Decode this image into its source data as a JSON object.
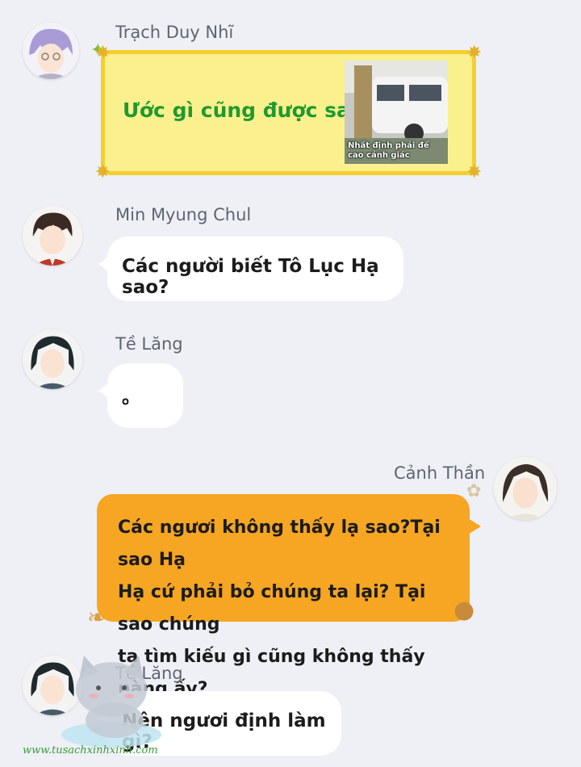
{
  "messages": [
    {
      "sender": "Trạch Duy Nhĩ",
      "text": "Ước gì cũng được sao?",
      "image_caption": "Nhất định phải để cao cảnh giác"
    },
    {
      "sender": "Min Myung Chul",
      "text": "Các người biết Tô Lục Hạ sao?"
    },
    {
      "sender": "Tề Lăng",
      "text": "。"
    },
    {
      "sender": "Cảnh Thần",
      "lines": [
        "Các ngươi không thấy lạ sao?Tại sao Hạ",
        "Hạ cứ phải bỏ chúng ta lại? Tại sao chúng",
        "ta tìm kiếu gì cũng không thấy nàng ấy?"
      ]
    },
    {
      "sender": "Tề Lăng",
      "text": "Nên ngươi định làm gì?"
    }
  ],
  "watermark": "www.tusachxinhxinh.com",
  "colors": {
    "background": "#eef0f6",
    "yellow_bubble": "#fbf08e",
    "yellow_border": "#f3cf2f",
    "green_text": "#1f9a2e",
    "orange_bubble": "#f6a623"
  }
}
